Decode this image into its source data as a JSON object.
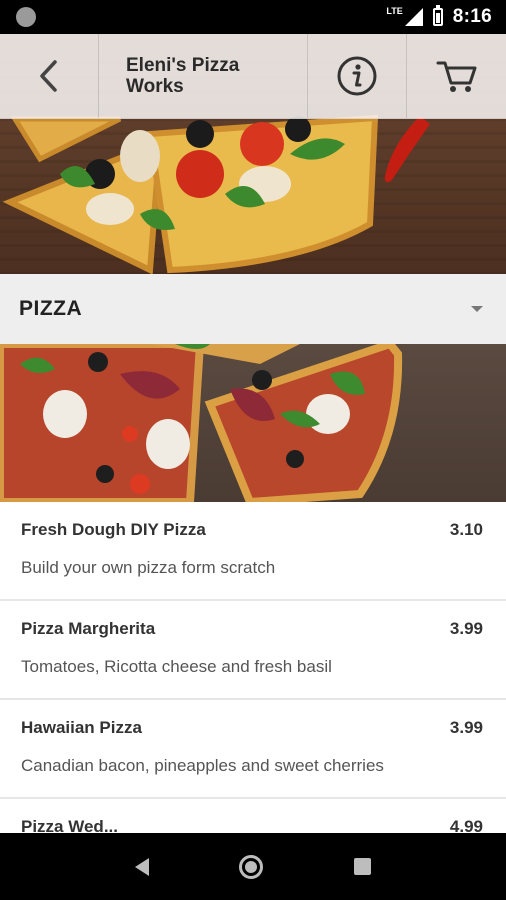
{
  "status_bar": {
    "network": "LTE",
    "time": "8:16"
  },
  "header": {
    "title": "Eleni's Pizza Works",
    "back_icon": "chevron-left-icon",
    "info_icon": "info-icon",
    "cart_icon": "cart-icon"
  },
  "category": {
    "title": "PIZZA",
    "expand_icon": "caret-down-icon"
  },
  "menu": {
    "items": [
      {
        "name": "Fresh Dough DIY Pizza",
        "price": "3.10",
        "description": "Build your own pizza form scratch"
      },
      {
        "name": "Pizza Margherita",
        "price": "3.99",
        "description": "Tomatoes, Ricotta cheese and fresh basil"
      },
      {
        "name": "Hawaiian Pizza",
        "price": "3.99",
        "description": "Canadian bacon, pineapples and sweet cherries"
      },
      {
        "name": "Pizza Wed...",
        "price": "4.99",
        "description": ""
      }
    ]
  },
  "colors": {
    "status_bar": "#000000",
    "header_overlay": "#f8f6f4",
    "category_bar": "#eeeeee",
    "divider": "#e6e6e6"
  }
}
